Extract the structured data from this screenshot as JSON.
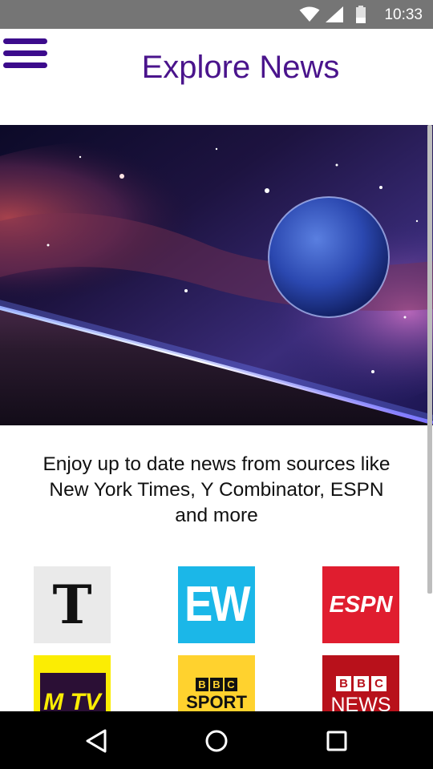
{
  "status_bar": {
    "time": "10:33",
    "icons": [
      "wifi-icon",
      "signal-icon",
      "battery-icon"
    ],
    "background": "#757575"
  },
  "header": {
    "title": "Explore News",
    "menu_icon": "hamburger-menu-icon",
    "title_color": "#4a148c"
  },
  "hero": {
    "image": "space-planet-illustration"
  },
  "description": "Enjoy up to date news from sources like New York Times, Y Combinator, ESPN and more",
  "sources": [
    {
      "id": "nyt",
      "text": "T",
      "background": "#eaeaea"
    },
    {
      "id": "ew",
      "text": "EW",
      "background": "#1bb7e8"
    },
    {
      "id": "espn",
      "text": "ESPN",
      "background": "#e01d2f"
    },
    {
      "id": "mtv",
      "text": "M TV",
      "background": "#fbed03"
    },
    {
      "id": "bbc-sport",
      "bbc": [
        "B",
        "B",
        "C"
      ],
      "text": "SPORT",
      "background": "#ffd22e"
    },
    {
      "id": "bbc-news",
      "bbc": [
        "B",
        "B",
        "C"
      ],
      "text": "NEWS",
      "background": "#b8111b"
    }
  ],
  "nav_bar": {
    "buttons": [
      "back-icon",
      "home-icon",
      "recents-icon"
    ]
  }
}
